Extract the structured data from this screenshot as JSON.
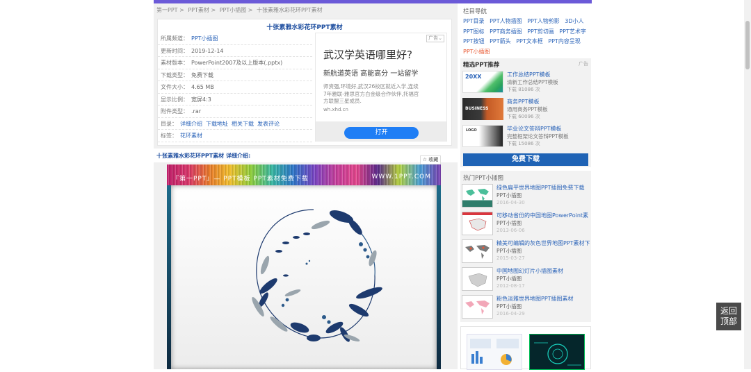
{
  "breadcrumb": [
    "第一PPT",
    ">",
    "PPT素材",
    ">",
    "PPT小插图",
    ">",
    "十张素雅水彩花环PPT素材"
  ],
  "detail": {
    "title": "十张素雅水彩花环PPT素材",
    "rows": [
      {
        "key": "所属频道：",
        "value": "PPT小插图",
        "link": true
      },
      {
        "key": "更新时间：",
        "value": "2019-12-14"
      },
      {
        "key": "素材版本：",
        "value": "PowerPoint2007及以上版本(.pptx)"
      },
      {
        "key": "下载类型：",
        "value": "免费下载"
      },
      {
        "key": "文件大小：",
        "value": "4.65 MB"
      },
      {
        "key": "显示比例：",
        "value": "宽屏4:3"
      },
      {
        "key": "附件类型：",
        "value": ".rar"
      }
    ],
    "toc_key": "目录：",
    "toc_links": [
      "详细介绍",
      "下载地址",
      "相关下载",
      "发表评论"
    ],
    "tag_key": "标签：",
    "tag_value": "花环素材"
  },
  "ad": {
    "tag": "广告",
    "headline": "武汉学英语哪里好?",
    "sub": "新航道英语 高能高分 一站留学",
    "desc": "师资强,环境好,武汉26校区就近入学,连续7年雅联-雅思官方白金级合作伙伴,托福官方联盟三星成员.",
    "domain": "wh.xhd.cn",
    "button": "打开"
  },
  "intro": {
    "title": "十张素雅水彩花环PPT素材 详细介绍:",
    "fav": "☆ 收藏"
  },
  "preview": {
    "caption": "『第一PPT』— PPT模板 PPT素材免费下载",
    "url": "WWW.1PPT.COM"
  },
  "sidebar": {
    "nav_title": "栏目导航",
    "nav_links": [
      "PPT目录",
      "PPT人物插图",
      "PPT人物剪影",
      "3D小人",
      "PPT图标",
      "PPT商务插图",
      "PPT剪切画",
      "PPT艺术字",
      "PPT按钮",
      "PPT箭头",
      "PPT文本框",
      "PPT内容呈现",
      "PPT小插图"
    ],
    "rec_title": "精选PPT推荐",
    "rec_ad": "广告",
    "rec_items": [
      {
        "title": "工作总结PPT模板",
        "desc": "清新工作总结PPT模板",
        "count": "下载 81086 次"
      },
      {
        "title": "商务PPT模板",
        "desc": "通用商务PPT模板",
        "count": "下载 60096 次"
      },
      {
        "title": "毕业论文答辩PPT模板",
        "desc": "完整框架论文答辩PPT模板",
        "count": "下载 15086 次"
      }
    ],
    "download_btn": "免费下载",
    "hot_title": "热门PPT小插图",
    "hot_items": [
      {
        "title": "绿色扁平世界地图PPT插图免费下载",
        "cat": "PPT小插图",
        "date": "2016-04-30"
      },
      {
        "title": "可移动省份的中国地图PowerPoint素",
        "cat": "PPT小插图",
        "date": "2013-06-06"
      },
      {
        "title": "精美可编辑的灰色世界地图PPT素材下",
        "cat": "PPT小插图",
        "date": "2015-03-27"
      },
      {
        "title": "中国地图幻灯片小插图素材",
        "cat": "PPT小插图",
        "date": "2012-08-17"
      },
      {
        "title": "粉色淡雅世界地图PPT插图素材",
        "cat": "PPT小插图",
        "date": "2016-04-29"
      }
    ],
    "thumb1_label": "20XX",
    "thumb2_label": "BUSINESS",
    "thumb3_label": "LOGO"
  },
  "back_top": [
    "返回",
    "顶部"
  ],
  "colors": {
    "accent": "#6b5ad8",
    "link": "#2a63b8",
    "button": "#1f63b5",
    "ad_button": "#1f7ef5"
  }
}
